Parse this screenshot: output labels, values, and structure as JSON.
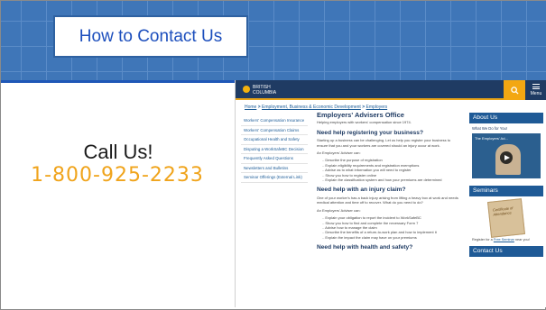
{
  "slide": {
    "title": "How to Contact Us",
    "call_label": "Call Us!",
    "phone": "1-800-925-2233"
  },
  "colors": {
    "header_blue": "#3f76b8",
    "title_blue": "#1d4fbd",
    "phone_orange": "#f0a41c",
    "site_navy": "#1f3b63",
    "site_gold": "#f3a712"
  },
  "site": {
    "logo_text": "BRITISH COLUMBIA",
    "search_icon": "search-icon",
    "menu_label": "Menu",
    "breadcrumb": [
      "Home",
      "Employment, Business & Economic Development",
      "Employers"
    ],
    "breadcrumb_sep": ">",
    "leftnav": [
      "Workers' Compensation Insurance",
      "Workers' Compensation Claims",
      "Occupational Health and Safety",
      "Disputing a WorkSafeBC Decision",
      "Frequently Asked Questions",
      "Newsletters and Bulletins",
      "Seminar Offerings (External Link)"
    ],
    "main": {
      "title": "Employers' Advisers Office",
      "intro": "Helping employers with workers' compensation since 1974.",
      "s1_heading": "Need help registering your business?",
      "s1_text": "Starting up a business can be challenging. Let us help you register your business to ensure that you and your workers are covered should an injury occur at work.",
      "s1_lead": "An Employers' Adviser can:",
      "s1_items": [
        "Describe the purpose of registration",
        "Explain eligibility requirements and registration exemptions",
        "Advise as to what information you will need to register",
        "Show you how to register online",
        "Explain the classification system and how your premiums are determined"
      ],
      "s2_heading": "Need help with an injury claim?",
      "s2_text": "One of your worker's has a back injury arising from lifting a heavy box at work and needs medical attention and time off to recover. What do you need to do?",
      "s2_lead": "An Employers' Adviser can:",
      "s2_items": [
        "Explain your obligation to report the incident to WorkSafeBC",
        "Show you how to find and complete the necessary Form 7",
        "Advise how to manage the claim",
        "Describe the benefits of a return-to-work plan and how to implement it",
        "Explain the impact the claim may have on your premiums"
      ],
      "s3_heading": "Need help with health and safety?"
    },
    "sidebar": {
      "about_heading": "About Us",
      "about_sub": "What We Do for You!",
      "video_title": "The Employers' Ad...",
      "play_icon": "play-icon",
      "seminars_heading": "Seminars",
      "seminar_image_text": "Certificate of Attendance",
      "seminar_note_pre": "Register for a ",
      "seminar_note_link": "Free Seminar",
      "seminar_note_post": " near you!",
      "contact_heading": "Contact Us"
    }
  }
}
